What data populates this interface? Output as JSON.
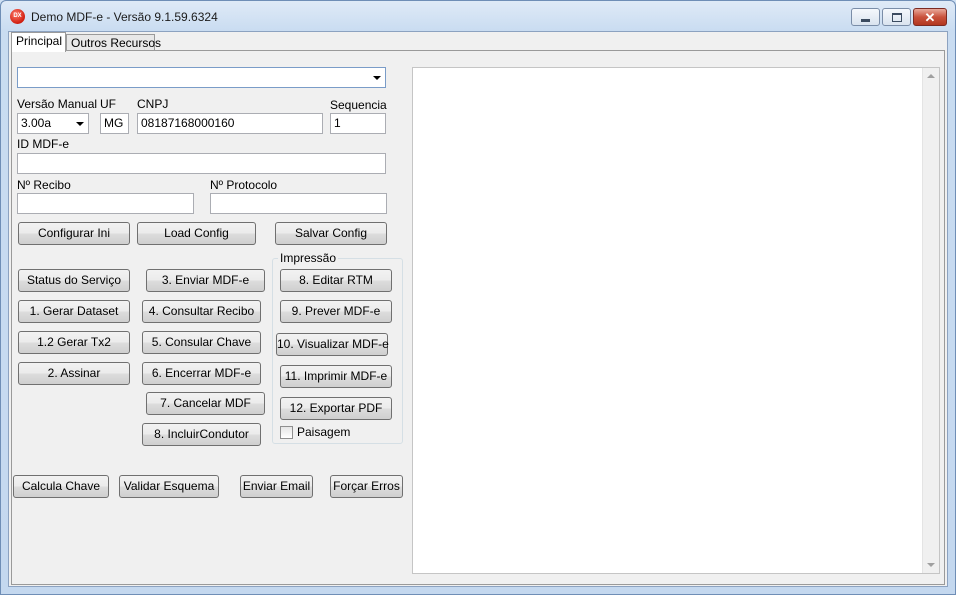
{
  "window": {
    "title": "Demo MDF-e - Versão 9.1.59.6324",
    "icon": "app-logo-icon",
    "icon_text": "DX"
  },
  "tabs": [
    "Principal",
    "Outros Recursos"
  ],
  "form": {
    "top_combo_value": "",
    "versao_label": "Versão Manual",
    "versao_value": "3.00a",
    "uf_label": "UF",
    "uf_value": "MG",
    "cnpj_label": "CNPJ",
    "cnpj_value": "08187168000160",
    "sequencia_label": "Sequencia",
    "sequencia_value": "1",
    "id_label": "ID MDF-e",
    "id_value": "",
    "recibo_label": "Nº Recibo",
    "recibo_value": "",
    "protocolo_label": "Nº Protocolo",
    "protocolo_value": ""
  },
  "config_buttons": {
    "configurar_ini": "Configurar Ini",
    "load_config": "Load Config",
    "salvar_config": "Salvar Config"
  },
  "service_buttons": {
    "status": "Status do Serviço",
    "gerar_dataset": "1. Gerar Dataset",
    "gerar_tx2": "1.2 Gerar Tx2",
    "assinar": "2. Assinar",
    "enviar": "3. Enviar MDF-e",
    "consultar_recibo": "4. Consultar Recibo",
    "consultar_chave": "5. Consular Chave",
    "encerrar": "6. Encerrar MDF-e",
    "cancelar": "7. Cancelar MDF",
    "incluir_condutor": "8. IncluirCondutor"
  },
  "impressao": {
    "title": "Impressão",
    "editar_rtm": "8. Editar RTM",
    "prever": "9. Prever MDF-e",
    "visualizar": "10. Visualizar MDF-e",
    "imprimir": "11. Imprimir MDF-e",
    "exportar_pdf": "12. Exportar PDF",
    "paisagem_label": "Paisagem",
    "paisagem_checked": false
  },
  "bottom_buttons": {
    "calcula_chave": "Calcula Chave",
    "validar_esquema": "Validar Esquema",
    "enviar_email": "Enviar Email",
    "forcar_erros": "Forçar Erros"
  },
  "colors": {
    "title_bg": "#c9dcf1",
    "close_button": "#c9523d",
    "client_bg": "#f0f0f0"
  }
}
